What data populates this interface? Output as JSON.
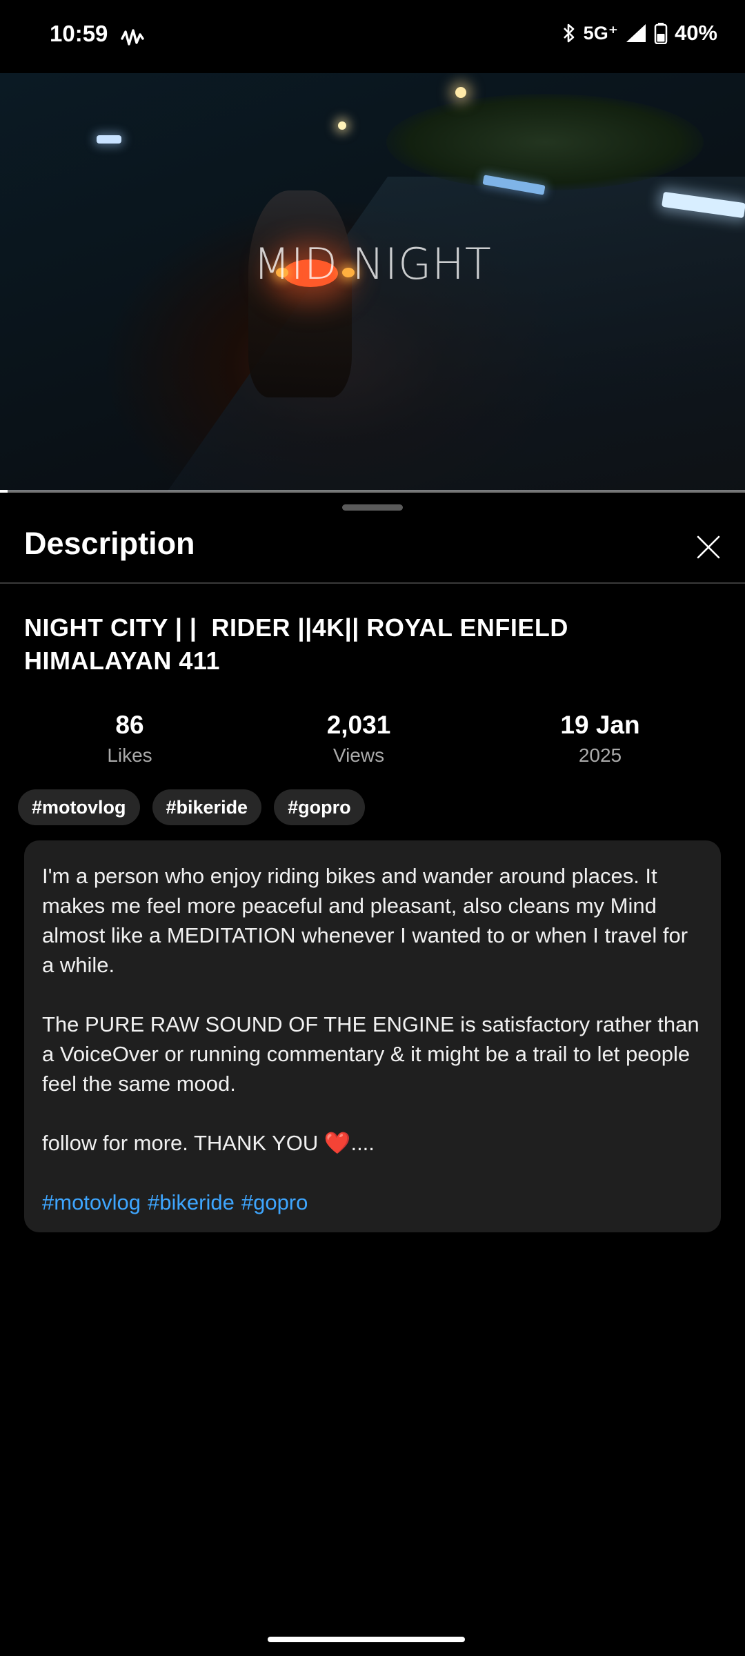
{
  "status_bar": {
    "time": "10:59",
    "network": "5G⁺",
    "battery": "40%",
    "battery_level": 0.4
  },
  "video": {
    "overlay_title": "MID NIGHT",
    "progress_fraction": 0.01
  },
  "sheet": {
    "title": "Description",
    "video_title": "NIGHT CITY | |  RIDER ||4K|| ROYAL ENFIELD HIMALAYAN 411",
    "stats": [
      {
        "value": "86",
        "label": "Likes"
      },
      {
        "value": "2,031",
        "label": "Views"
      },
      {
        "value": "19 Jan",
        "label": "2025"
      }
    ],
    "chips": [
      "#motovlog",
      "#bikeride",
      "#gopro"
    ],
    "description": {
      "para1": "I'm a person who enjoy riding bikes and wander around places. It makes me feel more peaceful and pleasant, also cleans my Mind almost like a MEDITATION whenever I wanted to or when I travel for a while.",
      "para2": "The PURE RAW SOUND OF THE ENGINE is satisfactory rather than a VoiceOver or running commentary & it might be a trail to let people feel the same mood.",
      "para3": "follow for more. THANK YOU ❤️....",
      "tags": [
        "#motovlog",
        "#bikeride",
        "#gopro"
      ]
    }
  },
  "colors": {
    "background": "#000000",
    "card": "#1f1f1f",
    "chip": "#272727",
    "link": "#3ea6ff",
    "muted": "#aaaaaa"
  }
}
